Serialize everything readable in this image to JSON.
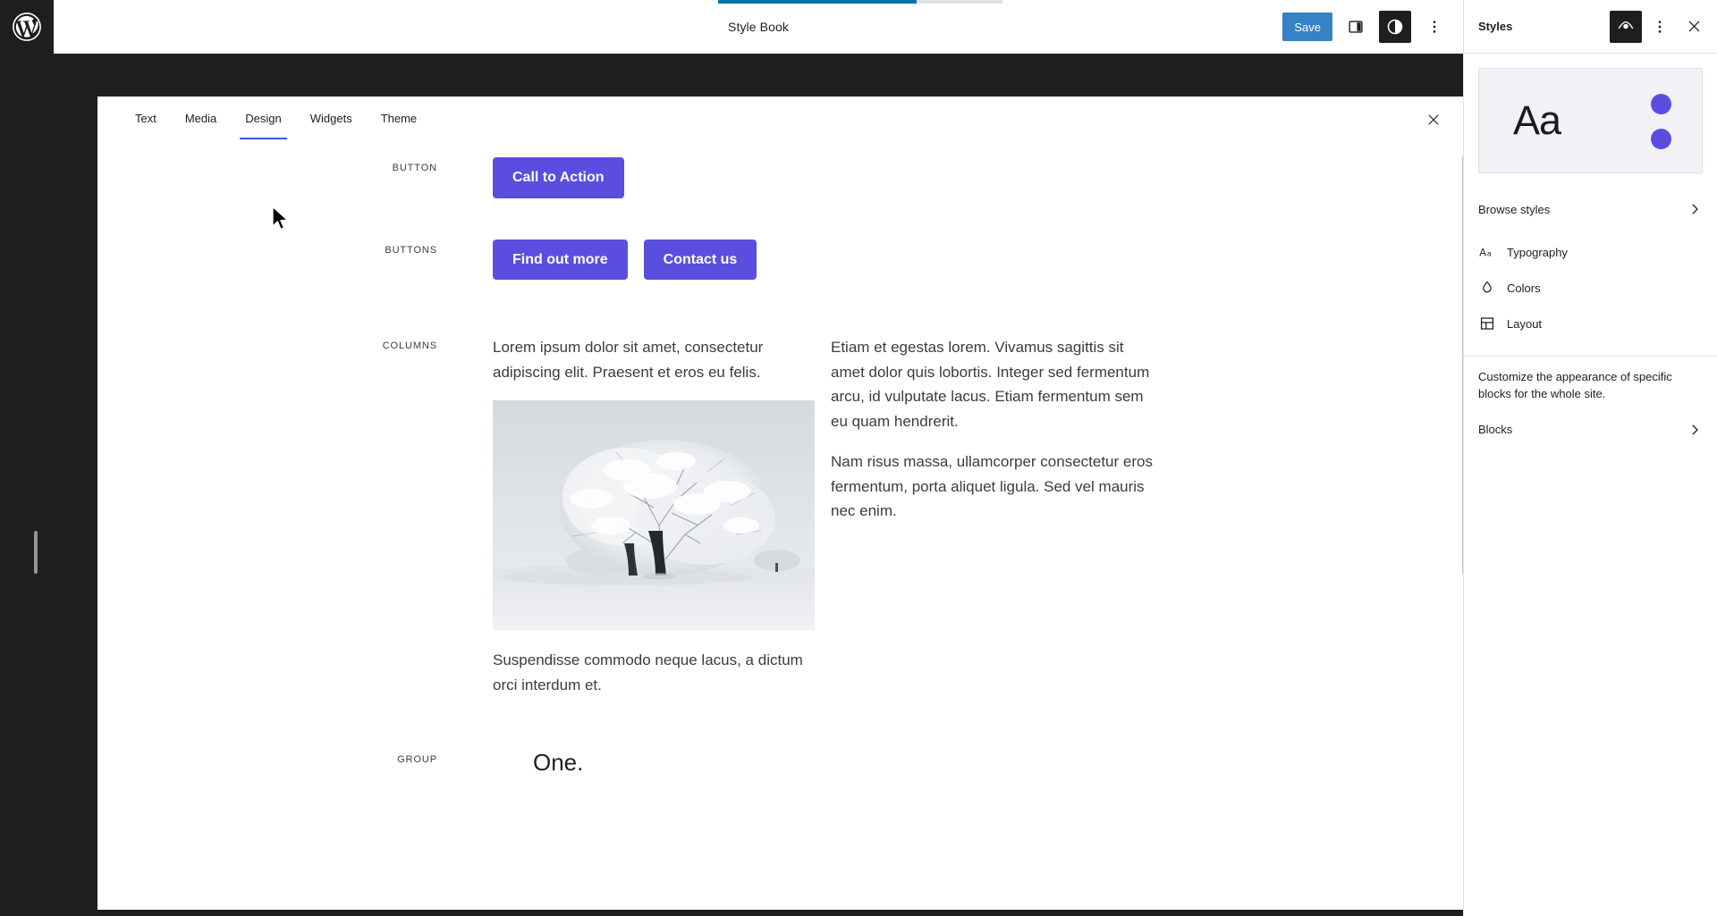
{
  "app": {
    "logo_icon": "wordpress-logo-icon"
  },
  "header": {
    "title": "Style Book",
    "save_label": "Save",
    "progress_percent": 70,
    "progress_color": "#0073aa",
    "save_color": "#3582c4",
    "buttons": [
      {
        "name": "sidebar-toggle",
        "icon": "sidebar-icon"
      },
      {
        "name": "styles-toggle",
        "icon": "contrast-icon",
        "active": true
      },
      {
        "name": "options-menu",
        "icon": "three-dots-vertical-icon"
      }
    ]
  },
  "styles_panel": {
    "title": "Styles",
    "header_buttons": [
      {
        "name": "revisions",
        "icon": "eye-icon",
        "active": true
      },
      {
        "name": "more-menu",
        "icon": "three-dots-vertical-icon",
        "active": false
      },
      {
        "name": "close",
        "icon": "close-icon",
        "active": false
      }
    ],
    "preview": {
      "sample_text": "Aa",
      "swatch_color": "#5a4ee0",
      "background": "#f3f1f6"
    },
    "browse_styles_label": "Browse styles",
    "menu_items": [
      {
        "label": "Typography",
        "icon": "typography-aa-icon"
      },
      {
        "label": "Colors",
        "icon": "color-droplet-icon"
      },
      {
        "label": "Layout",
        "icon": "layout-grid-icon"
      }
    ],
    "description": "Customize the appearance of specific blocks for the whole site.",
    "blocks_label": "Blocks"
  },
  "stylebook": {
    "tabs": [
      {
        "label": "Text",
        "active": false
      },
      {
        "label": "Media",
        "active": false
      },
      {
        "label": "Design",
        "active": true
      },
      {
        "label": "Widgets",
        "active": false
      },
      {
        "label": "Theme",
        "active": false
      }
    ],
    "active_tab_color": "#3858e9",
    "close_icon": "close-icon",
    "sections": [
      {
        "label": "BUTTON",
        "type": "button",
        "buttons": [
          "Call to Action"
        ]
      },
      {
        "label": "BUTTONS",
        "type": "buttons",
        "buttons": [
          "Find out more",
          "Contact us"
        ]
      },
      {
        "label": "COLUMNS",
        "type": "columns",
        "left_column": {
          "paragraph_top": "Lorem ipsum dolor sit amet, consectetur adipiscing elit. Praesent et eros eu felis.",
          "image_alt": "snow-covered-tree-photo",
          "paragraph_bottom": "Suspendisse commodo neque lacus, a dictum orci interdum et."
        },
        "right_column": {
          "paragraph_one": "Etiam et egestas lorem. Vivamus sagittis sit amet dolor quis lobortis. Integer sed fermentum arcu, id vulputate lacus. Etiam fermentum sem eu quam hendrerit.",
          "paragraph_two": "Nam risus massa, ullamcorper consectetur eros fermentum, porta aliquet ligula. Sed vel mauris nec enim."
        }
      },
      {
        "label": "GROUP",
        "type": "group",
        "heading": "One."
      }
    ],
    "button_color": "#5a4ee0"
  }
}
